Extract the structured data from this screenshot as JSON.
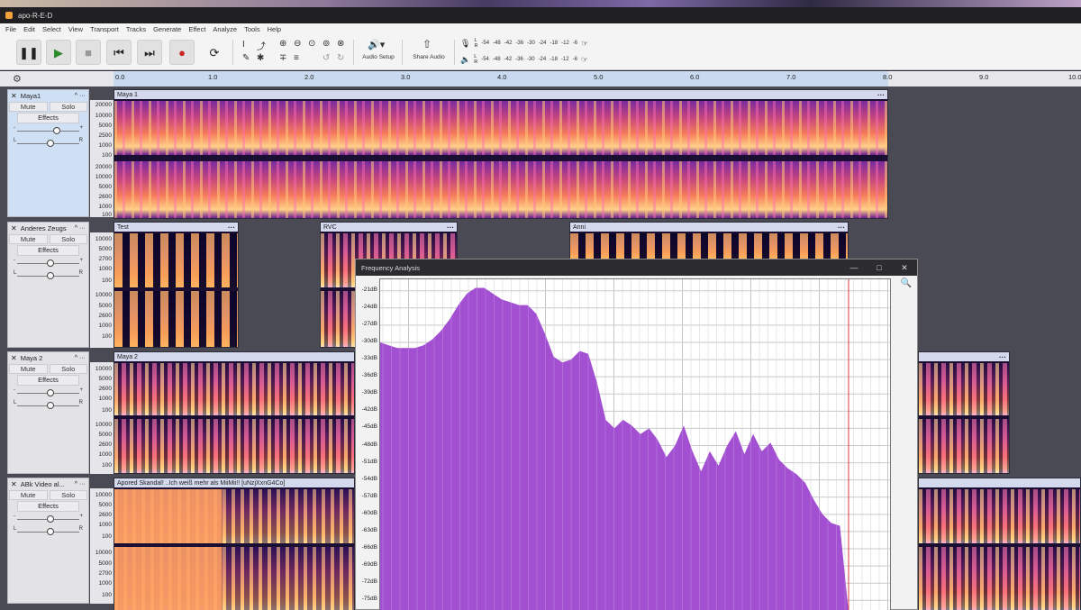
{
  "window": {
    "title": "apo-R-E-D"
  },
  "menu": [
    "File",
    "Edit",
    "Select",
    "View",
    "Transport",
    "Tracks",
    "Generate",
    "Effect",
    "Analyze",
    "Tools",
    "Help"
  ],
  "toolbar": {
    "audio_setup": "Audio Setup",
    "share_audio": "Share Audio",
    "rec_meter_ticks": [
      "-54",
      "-48",
      "-42",
      "-36",
      "-30",
      "-24",
      "-18",
      "-12",
      "-6"
    ],
    "play_meter_ticks": [
      "-54",
      "-48",
      "-42",
      "-36",
      "-30",
      "-24",
      "-18",
      "-12",
      "-6"
    ],
    "meter_lr": [
      "L",
      "R"
    ]
  },
  "ruler": {
    "ticks": [
      "0.0",
      "1.0",
      "2.0",
      "3.0",
      "4.0",
      "5.0",
      "6.0",
      "7.0",
      "8.0",
      "9.0",
      "10.0"
    ]
  },
  "track_controls": {
    "mute": "Mute",
    "solo": "Solo",
    "effects": "Effects",
    "minus": "-",
    "plus": "+",
    "left": "L",
    "right": "R"
  },
  "tracks": [
    {
      "name": "Maya1",
      "scale": [
        "20000",
        "10000",
        "5000",
        "2500",
        "1000",
        "100",
        "20000",
        "10000",
        "5000",
        "2600",
        "1000",
        "100"
      ],
      "clips": [
        {
          "label": "Maya 1"
        }
      ]
    },
    {
      "name": "Anderes Zeugs",
      "scale": [
        "10000",
        "5000",
        "2700",
        "1000",
        "100",
        "10000",
        "5000",
        "2600",
        "1000",
        "100"
      ],
      "clips": [
        {
          "label": "Test"
        },
        {
          "label": "RVC"
        },
        {
          "label": "Anni"
        }
      ]
    },
    {
      "name": "Maya 2",
      "scale": [
        "10000",
        "5000",
        "2600",
        "1000",
        "100",
        "10000",
        "5000",
        "2600",
        "1000",
        "100"
      ],
      "clips": [
        {
          "label": "Maya 2"
        },
        {
          "label": ""
        }
      ]
    },
    {
      "name": "ABk Video al...",
      "scale": [
        "10000",
        "5000",
        "2600",
        "1000",
        "100",
        "10000",
        "5000",
        "2700",
        "1000",
        "100"
      ],
      "clips": [
        {
          "label": "Apored Skandal! ..Ich weiß mehr als MiiMii!! [uNzjXxnG4Co]"
        },
        {
          "label": ""
        }
      ]
    }
  ],
  "freq_window": {
    "title": "Frequency Analysis",
    "y_labels": [
      "-21dB",
      "-24dB",
      "-27dB",
      "-30dB",
      "-33dB",
      "-36dB",
      "-39dB",
      "-42dB",
      "-45dB",
      "-48dB",
      "-51dB",
      "-54dB",
      "-57dB",
      "-60dB",
      "-63dB",
      "-66dB",
      "-69dB",
      "-72dB",
      "-75dB"
    ],
    "y_values": [
      -21,
      -24,
      -27,
      -30,
      -33,
      -36,
      -39,
      -42,
      -45,
      -48,
      -51,
      -54,
      -57,
      -60,
      -63,
      -66,
      -69,
      -72,
      -75
    ],
    "fill_color": "#a24fd1",
    "cursor_color": "#d9383a"
  },
  "chart_data": {
    "type": "area",
    "ylim": [
      -77,
      -19
    ],
    "y_ticks": [
      -21,
      -24,
      -27,
      -30,
      -33,
      -36,
      -39,
      -42,
      -45,
      -48,
      -51,
      -54,
      -57,
      -60,
      -63,
      -66,
      -69,
      -72,
      -75
    ],
    "series": [
      {
        "values": [
          -30,
          -30.5,
          -31,
          -31,
          -31,
          -30.5,
          -29.5,
          -28,
          -26,
          -23.5,
          -21.5,
          -20.5,
          -20.5,
          -21.5,
          -22.5,
          -23,
          -23.5,
          -23.5,
          -25,
          -28.5,
          -32.5,
          -33.5,
          -33,
          -31.5,
          -32,
          -37,
          -43.5,
          -45,
          -43.5,
          -44.5,
          -46,
          -45,
          -47,
          -50,
          -48,
          -44.5,
          -49,
          -52.5,
          -49,
          -51.5,
          -48,
          -45.5,
          -49.5,
          -46,
          -49,
          -47.5,
          -50.5,
          -52,
          -53,
          -54.5,
          -57.5,
          -60,
          -61.5,
          -62,
          -77
        ]
      }
    ]
  }
}
